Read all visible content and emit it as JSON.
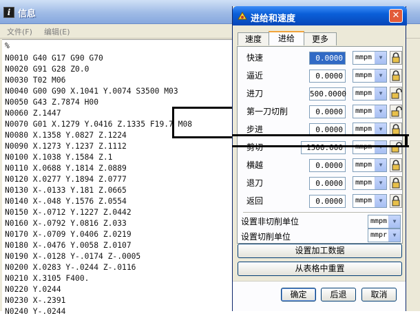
{
  "info_window": {
    "title": "信息",
    "icon": "info-i-icon",
    "menu": [
      "文件(F)",
      "编辑(E)"
    ],
    "code_lines": [
      "%",
      "N0010 G40 G17 G90 G70",
      "N0020 G91 G28 Z0.0",
      "N0030 T02 M06",
      "N0040 G00 G90 X.1041 Y.0074 S3500 M03",
      "N0050 G43 Z.7874 H00",
      "N0060 Z.1447",
      "N0070 G01 X.1279 Y.0416 Z.1335 F19.7 M08",
      "N0080 X.1358 Y.0827 Z.1224",
      "N0090 X.1273 Y.1237 Z.1112",
      "N0100 X.1038 Y.1584 Z.1",
      "N0110 X.0688 Y.1814 Z.0889",
      "N0120 X.0277 Y.1894 Z.0777",
      "N0130 X-.0133 Y.181 Z.0665",
      "N0140 X-.048 Y.1576 Z.0554",
      "N0150 X-.0712 Y.1227 Z.0442",
      "N0160 X-.0792 Y.0816 Z.033",
      "N0170 X-.0709 Y.0406 Z.0219",
      "N0180 X-.0476 Y.0058 Z.0107",
      "N0190 X-.0128 Y-.0174 Z-.0005",
      "N0200 X.0283 Y-.0244 Z-.0116",
      "N0210 X.3105 F400.",
      "N0220 Y.0244",
      "N0230 X-.2391",
      "N0240 Y-.0244"
    ]
  },
  "dialog": {
    "title": "进给和速度",
    "close_label": "✕",
    "tabs": [
      "速度",
      "进给",
      "更多"
    ],
    "active_tab": "进给",
    "rows": [
      {
        "label": "快速",
        "value": "0.0000",
        "unit": "mmpm",
        "lock": "locked",
        "selected": true
      },
      {
        "label": "逼近",
        "value": "0.0000",
        "unit": "mmpm",
        "lock": "locked",
        "selected": false
      },
      {
        "label": "进刀",
        "value": "500.0000",
        "unit": "mmpm",
        "lock": "unlocked",
        "selected": false
      },
      {
        "label": "第一刀切削",
        "value": "0.0000",
        "unit": "mmpm",
        "lock": "unlocked",
        "selected": false
      },
      {
        "label": "步进",
        "value": "0.0000",
        "unit": "mmpm",
        "lock": "locked",
        "selected": false
      },
      {
        "label": "剪切",
        "value": "1500.000",
        "unit": "mmpm",
        "lock": "unlocked",
        "selected": false
      },
      {
        "label": "横越",
        "value": "0.0000",
        "unit": "mmpm",
        "lock": "locked",
        "selected": false
      },
      {
        "label": "退刀",
        "value": "0.0000",
        "unit": "mmpm",
        "lock": "locked",
        "selected": false
      },
      {
        "label": "返回",
        "value": "0.0000",
        "unit": "mmpm",
        "lock": "locked",
        "selected": false
      }
    ],
    "non_cut_unit_label": "设置非切削单位",
    "non_cut_unit_value": "mmpm",
    "cut_unit_label": "设置切削单位",
    "cut_unit_value": "mmpr",
    "set_machining_data_label": "设置加工数据",
    "reset_from_table_label": "从表格中重置",
    "ok_label": "确定",
    "back_label": "后退",
    "cancel_label": "取消"
  },
  "colors": {
    "dialog_title_bar": "#0a5fd8",
    "selection": "#316ac5",
    "annotation": "#000000"
  }
}
